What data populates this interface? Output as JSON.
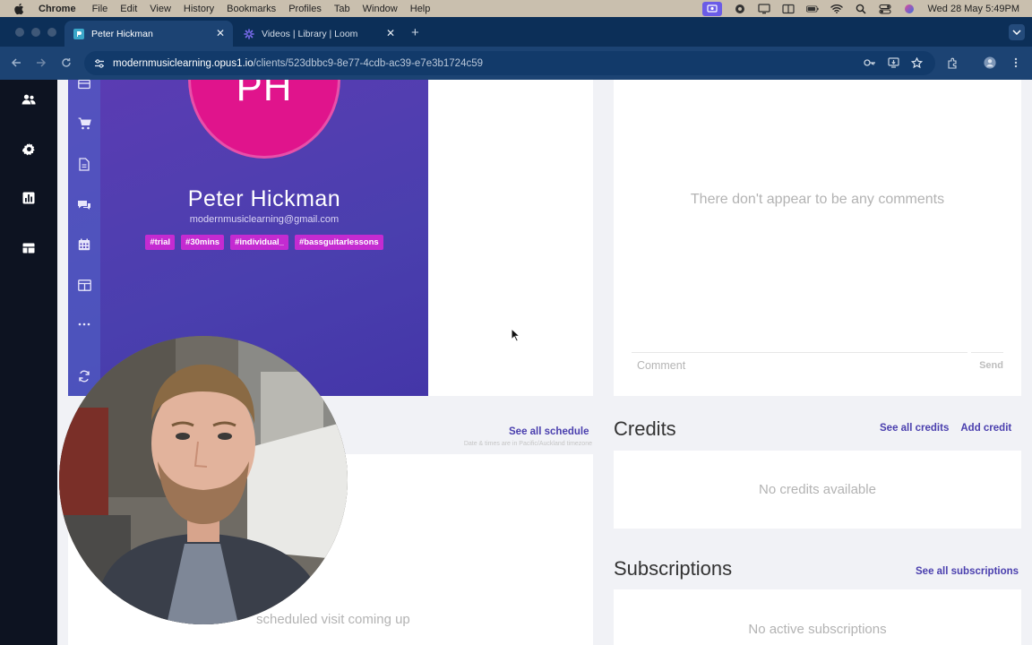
{
  "menubar": {
    "app": "Chrome",
    "items": [
      "File",
      "Edit",
      "View",
      "History",
      "Bookmarks",
      "Profiles",
      "Tab",
      "Window",
      "Help"
    ],
    "clock": "Wed 28 May  5:49PM"
  },
  "tabs": [
    {
      "title": "Peter Hickman",
      "icon": "opus-favicon-icon",
      "active": true
    },
    {
      "title": "Videos | Library | Loom",
      "icon": "loom-favicon-icon",
      "active": false
    }
  ],
  "address": {
    "host": "modernmusiclearning.opus1.io",
    "path": "/clients/523dbbc9-8e77-4cdb-ac39-e7e3b1724c59"
  },
  "app_sidebar": [
    "users-icon",
    "gear-icon",
    "bar-chart-icon",
    "dashboard-icon"
  ],
  "profile": {
    "initials": "PH",
    "name": "Peter Hickman",
    "email": "modernmusiclearning@gmail.com",
    "tags": [
      "#trial",
      "#30mins",
      "#individual_",
      "#bassguitarlessons"
    ],
    "rail_icons": [
      "card-icon",
      "cart-icon",
      "document-icon",
      "chat-icon",
      "calendar-icon",
      "table-icon",
      "more-icon",
      "refresh-icon"
    ]
  },
  "comments": {
    "empty": "There don't appear to be any comments",
    "placeholder": "Comment",
    "send": "Send"
  },
  "schedule": {
    "see_all": "See all schedule",
    "tz_note": "Date & times are in Pacific/Auckland timezone",
    "empty": "scheduled visit coming up"
  },
  "credits": {
    "title": "Credits",
    "see_all": "See all credits",
    "add": "Add credit",
    "empty": "No credits available"
  },
  "subscriptions": {
    "title": "Subscriptions",
    "see_all": "See all subscriptions",
    "empty": "No active subscriptions"
  },
  "colors": {
    "accent": "#4a3fae",
    "avatar": "#e0148c",
    "tag": "#c42bd1",
    "browser_frame": "#0c2f58"
  }
}
